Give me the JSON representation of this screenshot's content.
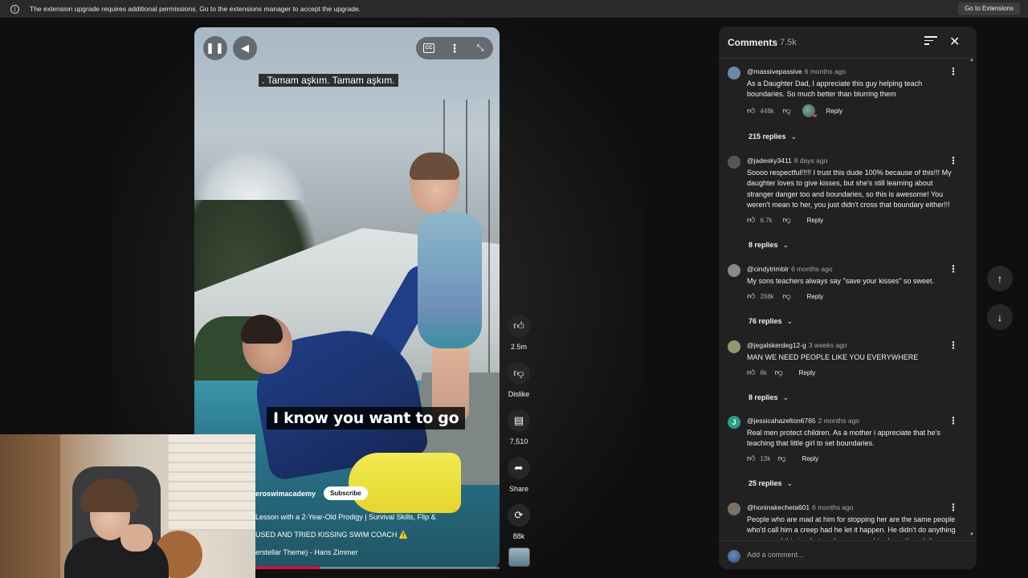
{
  "notice": {
    "message": "The extension upgrade requires additional permissions. Go to the extensions manager to accept the upgrade.",
    "action": "Go to Extensions",
    "icon": "info-icon"
  },
  "video": {
    "top_caption": ".  Tamam aşkım.  Tamam aşkım.",
    "main_caption": "I know you want to go",
    "channel": "eroswimacademy",
    "subscribe": "Subscribe",
    "title_lines": [
      "Lesson with a 2-Year-Old Prodigy | Survival Skills, Flip &",
      "USED AND TRIED KISSING SWIM COACH ⚠️",
      "erstellar Theme) - Hans Zimmer"
    ],
    "progress": 0.41,
    "cc_label": "CC",
    "accent": "#ff0033"
  },
  "actions": {
    "like": "2.5m",
    "dislike": "Dislike",
    "comments": "7,510",
    "share": "Share",
    "remix": "88k"
  },
  "comments_panel": {
    "title": "Comments",
    "count": "7.5k",
    "add_placeholder": "Add a comment...",
    "items": [
      {
        "handle": "@massivepassive",
        "ago": "6 months ago",
        "text": "As a Daughter Dad, I appreciate this guy helping teach boundaries. So much better than blurring them",
        "likes": "448k",
        "reply": "Reply",
        "creator_heart": true,
        "replies": "215 replies",
        "avatar_color": "#6b8aa8"
      },
      {
        "handle": "@jadesky3411",
        "ago": "8 days ago",
        "text": "Soooo respectful!!!!! I trust this dude 100% because of this!!! My daughter loves to give kisses, but she's still learning about stranger danger too and boundaries, so this is awesome! You weren't mean to her, you just didn't cross that boundary either!!!",
        "likes": "6.7k",
        "reply": "Reply",
        "replies": "8 replies",
        "avatar_color": "#5b5550"
      },
      {
        "handle": "@cindytrimblr",
        "ago": "6 months ago",
        "text": "My sons teachers always say \"save your kisses\" so sweet.",
        "likes": "268k",
        "reply": "Reply",
        "replies": "76 replies",
        "avatar_color": "#8a8a8a"
      },
      {
        "handle": "@jegalskerdeg12-g",
        "ago": "3 weeks ago",
        "text": "MAN WE NEED PEOPLE LIKE YOU EVERYWHERE",
        "likes": "6k",
        "reply": "Reply",
        "replies": "8 replies",
        "avatar_color": "#8c9b6e"
      },
      {
        "handle": "@jessicahazelton6765",
        "ago": "2 months ago",
        "text": "Real men protect children. As a mother i appreciate that he's teaching that little girl to set boundaries.",
        "likes": "13k",
        "reply": "Reply",
        "replies": "25 replies",
        "avatar_color": "#2a9d8f",
        "avatar_letter": "J"
      },
      {
        "handle": "@honinakecheta601",
        "ago": "6 months ago",
        "text": "People who are mad at him for stopping her are the same people who'd call him a creep had he let it happen. He didn't do anything wrong, and this is what you're supposed to do as the adult.",
        "avatar_color": "#7a7064"
      }
    ]
  }
}
